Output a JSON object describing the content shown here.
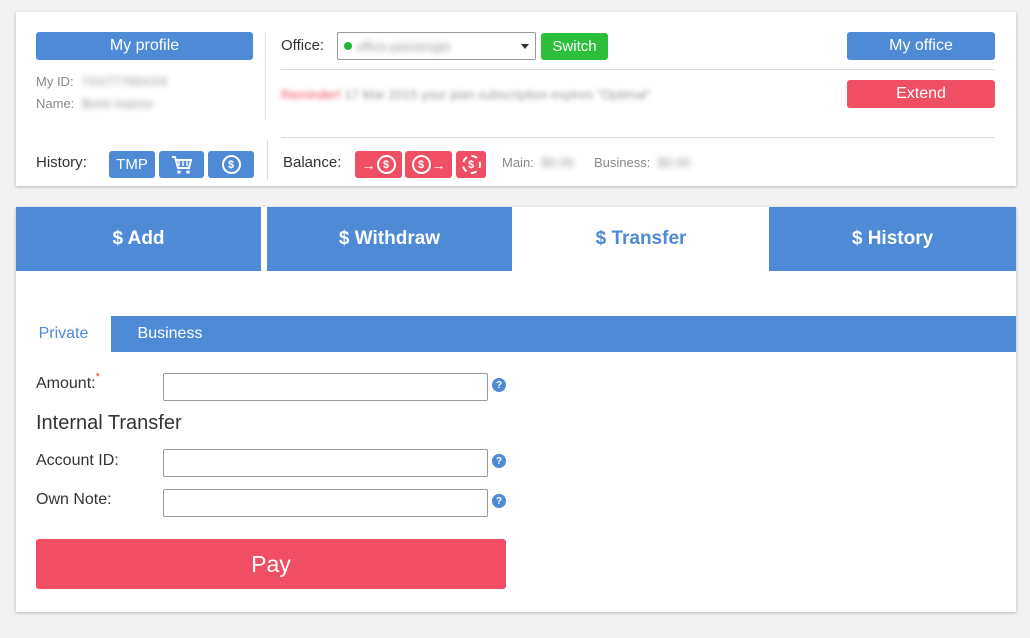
{
  "profile": {
    "button": "My profile",
    "id_label": "My ID:",
    "id_value": "7XX77766XXX",
    "name_label": "Name:",
    "name_value": "Boris Ivanov"
  },
  "office": {
    "label": "Office:",
    "selected": "office.passenger",
    "switch_label": "Switch",
    "my_office": "My office",
    "notice_highlight": "Reminder!",
    "notice_text": "17 Mar 2015 your plan subscription expires \"Optimal\"",
    "extend_label": "Extend"
  },
  "history": {
    "label": "History:",
    "tmp_label": "TMP",
    "cart_icon": "cart-icon",
    "dollar_icon": "dollar-coin-icon"
  },
  "balance": {
    "label": "Balance:",
    "main_label": "Main:",
    "main_value": "$0.00",
    "business_label": "Business:",
    "business_value": "$0.00"
  },
  "tabs": [
    {
      "label": "$ Add"
    },
    {
      "label": "$ Withdraw"
    },
    {
      "label": "$ Transfer"
    },
    {
      "label": "$ History"
    }
  ],
  "subtabs": [
    {
      "label": "Private"
    },
    {
      "label": "Business"
    }
  ],
  "form": {
    "amount_label": "Amount:",
    "required_mark": "*",
    "section_title": "Internal Transfer",
    "account_label": "Account ID:",
    "note_label": "Own Note:",
    "amount_value": "",
    "account_value": "",
    "note_value": "",
    "help_glyph": "?",
    "pay_label": "Pay"
  },
  "colors": {
    "primary": "#4e8ad6",
    "danger": "#f04e62",
    "success": "#2cbf3c"
  }
}
